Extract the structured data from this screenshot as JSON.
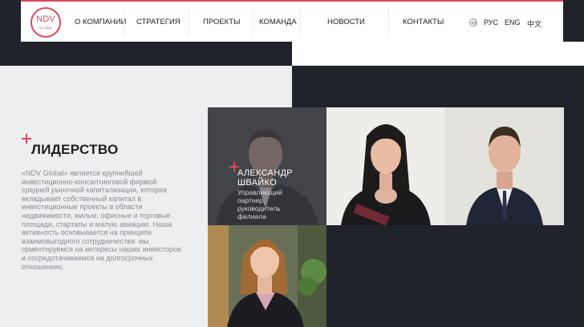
{
  "brand": {
    "logo_text": "NDV",
    "logo_sub": "GLOBAL"
  },
  "nav": {
    "items": [
      {
        "label": "О КОМПАНИИ"
      },
      {
        "label": "СТРАТЕГИЯ"
      },
      {
        "label": "ПРОЕКТЫ"
      },
      {
        "label": "КОМАНДА"
      },
      {
        "label": "НОВОСТИ"
      },
      {
        "label": "КОНТАКТЫ"
      }
    ],
    "languages": [
      {
        "label": "РУС"
      },
      {
        "label": "ENG"
      },
      {
        "label": "中文"
      }
    ]
  },
  "section": {
    "heading": "ЛИДЕРСТВО",
    "description": "«NDV Global» является крупнейшей инвестиционно-консалтинговой фирмой средней рыночной капитализации, которая вкладывает собственный капитал в инвестиционные проекты в области недвижимости, жилые, офисные и торговые площади, стартапы и малую авиацию. Наша активность основывается на принципе взаимовыгодного сотрудничества: мы ориентируемся на интересы наших инвесторов и сосредотачиваемся на долгосрочных отношениях."
  },
  "team": [
    {
      "name_line1": "АЛЕКСАНДР",
      "name_line2": "ШВАЙКО",
      "role_line1": "Управляющий",
      "role_line2": "партнер,",
      "role_line3": "руководитель",
      "role_line4": "филиала"
    }
  ],
  "colors": {
    "accent": "#d94a5a",
    "dark_bg": "#21232b",
    "light_bg": "#eceef0"
  }
}
